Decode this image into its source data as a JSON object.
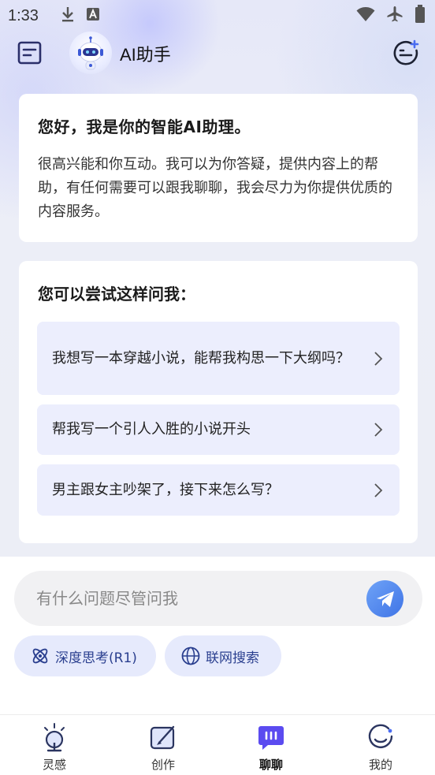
{
  "status_bar": {
    "time": "1:33",
    "icons": [
      "download-icon",
      "font-icon",
      "wifi-icon",
      "airplane-icon",
      "battery-icon"
    ]
  },
  "header": {
    "title": "AI助手",
    "menu_icon": "document-list-icon",
    "avatar": "robot-avatar",
    "new_chat_icon": "smile-plus-icon"
  },
  "greeting": {
    "title": "您好，我是你的智能AI助理。",
    "body": "很高兴能和你互动。我可以为你答疑，提供内容上的帮助，有任何需要可以跟我聊聊，我会尽力为你提供优质的内容服务。"
  },
  "suggestions": {
    "title": "您可以尝试这样问我：",
    "items": [
      {
        "label": "我想写一本穿越小说，能帮我构思一下大纲吗？"
      },
      {
        "label": "帮我写一个引人入胜的小说开头"
      },
      {
        "label": "男主跟女主吵架了，接下来怎么写？"
      }
    ]
  },
  "input": {
    "placeholder": "有什么问题尽管问我",
    "send_icon": "paper-plane-icon"
  },
  "chips": [
    {
      "label": "深度思考(R1)",
      "icon": "atom-icon"
    },
    {
      "label": "联网搜索",
      "icon": "globe-icon"
    }
  ],
  "tabs": [
    {
      "label": "灵感",
      "icon": "lightbulb-icon",
      "active": false
    },
    {
      "label": "创作",
      "icon": "pen-icon",
      "active": false
    },
    {
      "label": "聊聊",
      "icon": "chat-icon",
      "active": true
    },
    {
      "label": "我的",
      "icon": "profile-icon",
      "active": false
    }
  ],
  "colors": {
    "accent": "#4a6cf0",
    "chip_text": "#2a3f8f",
    "suggestion_bg": "#eceefd"
  }
}
